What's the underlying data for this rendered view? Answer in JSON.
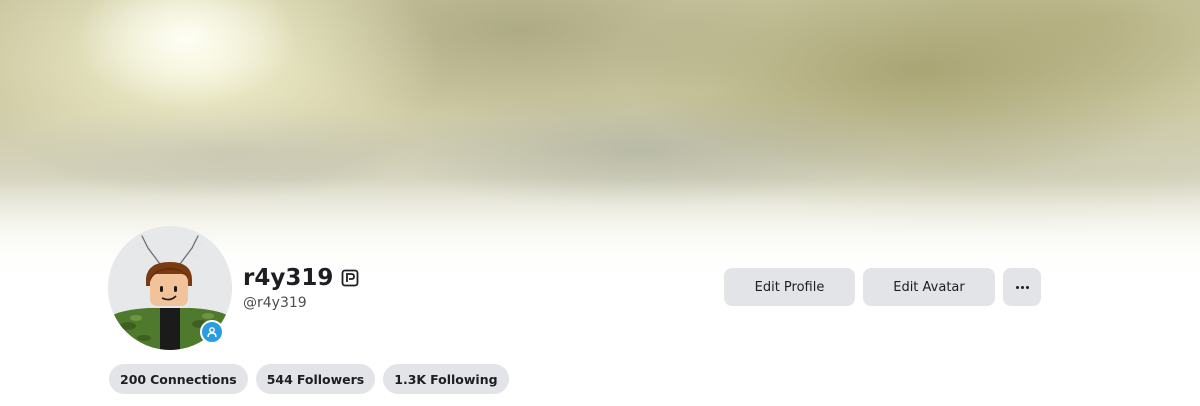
{
  "profile": {
    "display_name": "r4y319",
    "username": "@r4y319",
    "verified_icon": "premium-badge-icon",
    "avatar_badge_icon": "person-icon"
  },
  "actions": {
    "edit_profile_label": "Edit Profile",
    "edit_avatar_label": "Edit Avatar",
    "more_icon": "more-dots-icon"
  },
  "stats": {
    "connections_count": "200",
    "connections_label": "Connections",
    "followers_count": "544",
    "followers_label": "Followers",
    "following_count": "1.3K",
    "following_label": "Following"
  },
  "colors": {
    "button_bg": "#e3e4e8",
    "badge_blue": "#2d9be0",
    "text": "#1d1e22"
  }
}
